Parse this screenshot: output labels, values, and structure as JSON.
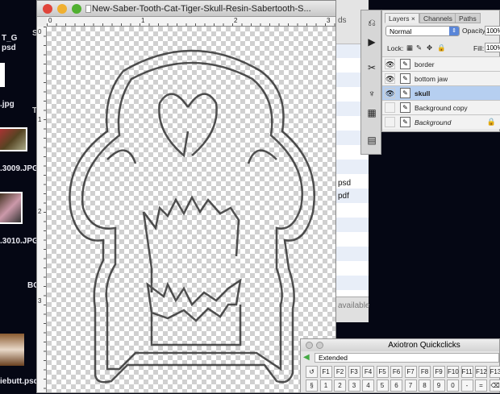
{
  "desktop": {
    "labels": [
      "T_G",
      "psd",
      ".jpg",
      ".3009.JPG",
      ".3010.JPG",
      "BO",
      "iebutt.psd",
      "S",
      "T"
    ]
  },
  "document": {
    "title": "New-Saber-Tooth-Cat-Tiger-Skull-Resin-Sabertooth-S...",
    "ruler_top": [
      "0",
      "1",
      "2",
      "3"
    ],
    "ruler_left": [
      "0",
      "1",
      "2",
      "3"
    ]
  },
  "finder": {
    "items": [
      "ds",
      "psd",
      "pdf",
      "available"
    ]
  },
  "tools": {
    "icons": [
      "history-icon",
      "actions-icon",
      "tool-presets-icon",
      "brushes-icon",
      "clone-source-icon",
      "info-icon"
    ]
  },
  "layers_panel": {
    "tabs": [
      "Layers",
      "Channels",
      "Paths"
    ],
    "blend_mode": "Normal",
    "opacity_label": "Opacity:",
    "opacity": "100%",
    "lock_label": "Lock:",
    "fill_label": "Fill:",
    "fill": "100%",
    "layers": [
      {
        "name": "border",
        "visible": true,
        "selected": false
      },
      {
        "name": "bottom jaw",
        "visible": true,
        "selected": false
      },
      {
        "name": "skull",
        "visible": true,
        "selected": true
      },
      {
        "name": "Background copy",
        "visible": false,
        "selected": false
      },
      {
        "name": "Background",
        "visible": false,
        "selected": false,
        "locked": true
      }
    ]
  },
  "quickclicks": {
    "title": "Axiotron Quickclicks",
    "preset": "Extended",
    "row1": [
      "↺",
      "F1",
      "F2",
      "F3",
      "F4",
      "F5",
      "F6",
      "F7",
      "F8",
      "F9",
      "F10",
      "F11",
      "F12",
      "F13"
    ],
    "row2": [
      "§",
      "1",
      "2",
      "3",
      "4",
      "5",
      "6",
      "7",
      "8",
      "9",
      "0",
      "-",
      "=",
      "⌫"
    ]
  },
  "colors": {
    "selection": "#b6cff0",
    "desktop": "#050714"
  }
}
